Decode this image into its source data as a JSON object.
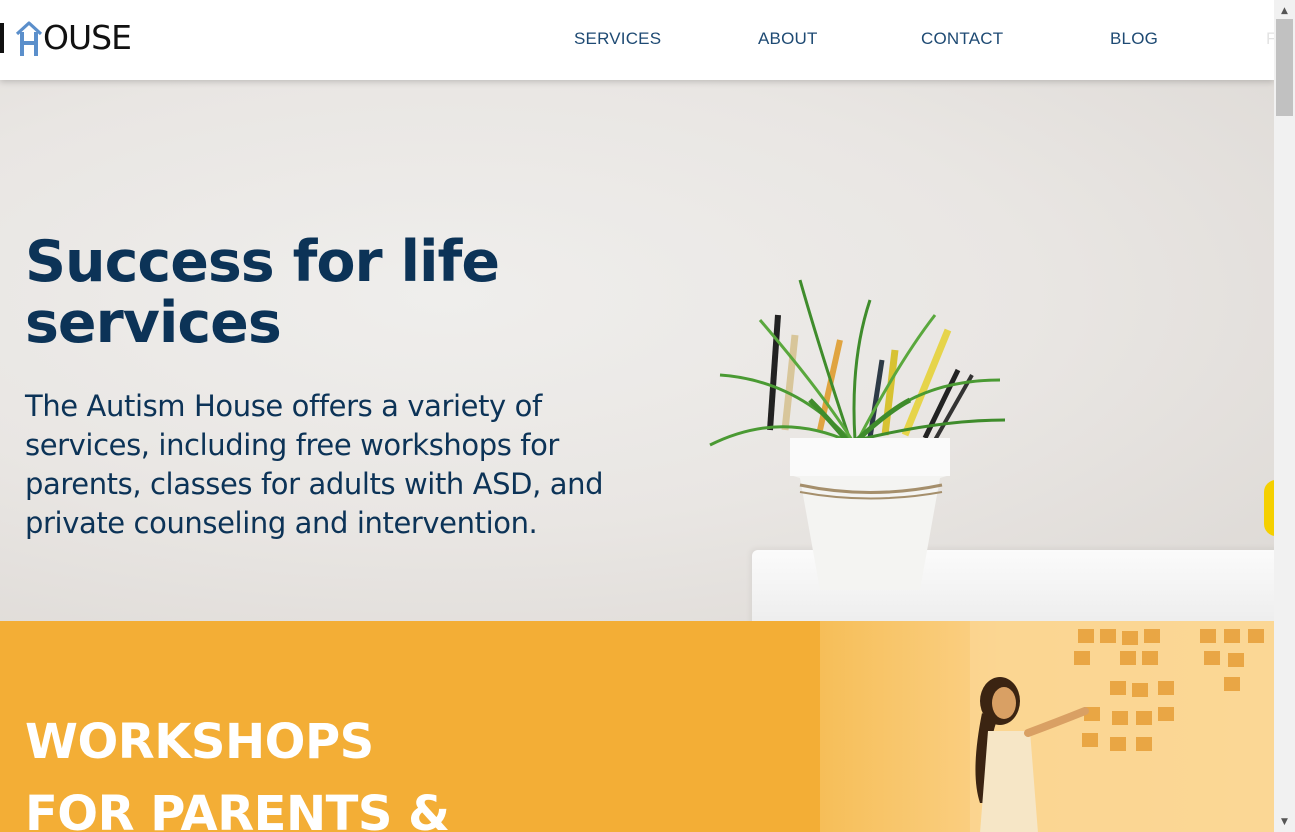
{
  "header": {
    "logo_text": "OUSE",
    "nav": [
      {
        "label": "SERVICES"
      },
      {
        "label": "ABOUT"
      },
      {
        "label": "CONTACT"
      },
      {
        "label": "BLOG"
      },
      {
        "label": "F"
      }
    ]
  },
  "hero": {
    "title_line1": "Success for life",
    "title_line2": "services",
    "description": "The Autism House offers a variety of services, including free workshops for parents, classes for adults with ASD, and private counseling and intervention."
  },
  "workshops": {
    "title_line1": "WORKSHOPS",
    "title_line2": "FOR PARENTS &"
  },
  "colors": {
    "brand_navy": "#0c3357",
    "nav_text": "#1e4a73",
    "logo_blue": "#5b8fcb",
    "workshop_orange": "#f3ae36"
  },
  "icons": {
    "logo": "house-logo-icon",
    "scroll_up": "scroll-up-arrow-icon",
    "scroll_down": "scroll-down-arrow-icon"
  }
}
